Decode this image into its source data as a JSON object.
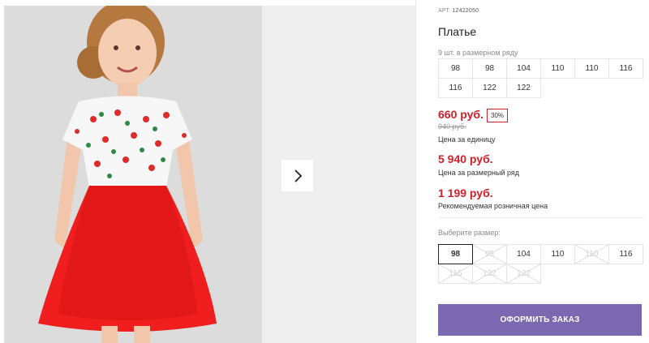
{
  "product": {
    "article_label": "АРТ.",
    "article_number": "12422050",
    "title": "Платье",
    "sizes_in_series_note": "9 шт. в размерном ряду",
    "series_sizes": [
      "98",
      "98",
      "104",
      "110",
      "110",
      "116",
      "116",
      "122",
      "122"
    ]
  },
  "pricing": {
    "price": "660 руб.",
    "discount": "30%",
    "old_price": "940 руб.",
    "unit_caption": "Цена за единицу",
    "series_price": "5 940 руб.",
    "series_caption": "Цена за размерный ряд",
    "retail_price": "1 199 руб.",
    "retail_caption": "Рекомендуемая розничная цена"
  },
  "size_choice": {
    "label": "Выберите размер:",
    "options": [
      {
        "label": "98",
        "state": "selected"
      },
      {
        "label": "98",
        "state": "disabled"
      },
      {
        "label": "104",
        "state": "available"
      },
      {
        "label": "110",
        "state": "available"
      },
      {
        "label": "110",
        "state": "disabled"
      },
      {
        "label": "116",
        "state": "available"
      },
      {
        "label": "116",
        "state": "disabled"
      },
      {
        "label": "122",
        "state": "disabled"
      },
      {
        "label": "122",
        "state": "disabled"
      }
    ]
  },
  "order_button": "ОФОРМИТЬ ЗАКАЗ",
  "gallery": {
    "next_icon": "chevron-right-icon"
  },
  "colors": {
    "price_red": "#d0202a",
    "button_purple": "#7b68b1"
  }
}
